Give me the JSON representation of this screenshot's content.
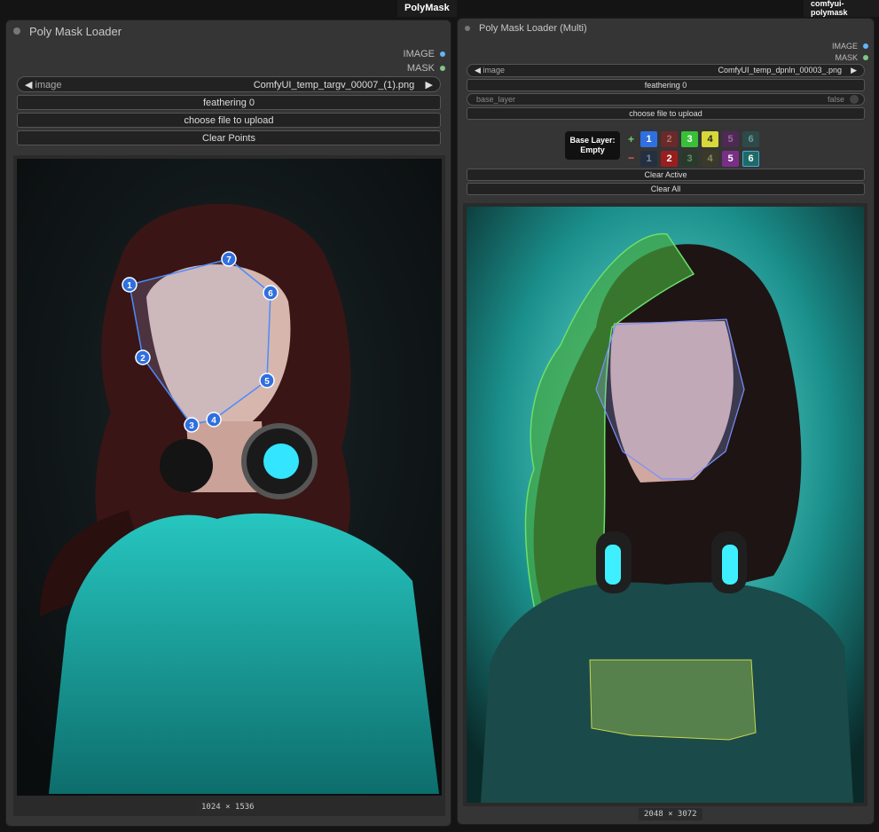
{
  "header": {
    "left_group": "PolyMask",
    "right_group": "comfyui-polymask"
  },
  "left_node": {
    "title": "Poly Mask Loader",
    "outputs": [
      "IMAGE",
      "MASK"
    ],
    "image_label": "image",
    "image_value": "ComfyUI_temp_targv_00007_(1).png",
    "feathering": "feathering  0",
    "upload": "choose file to upload",
    "clear": "Clear Points",
    "dims": "1024 × 1536",
    "points": [
      "1",
      "2",
      "3",
      "4",
      "5",
      "6",
      "7"
    ]
  },
  "right_node": {
    "title": "Poly Mask Loader (Multi)",
    "outputs": [
      "IMAGE",
      "MASK"
    ],
    "image_label": "image",
    "image_value": "ComfyUI_temp_dpnln_00003_.png",
    "feathering": "feathering  0",
    "base_layer_label": "base_layer",
    "base_layer_value": "false",
    "upload": "choose file to upload",
    "base_layer_status": "Base Layer: Empty",
    "plus": "+",
    "minus": "−",
    "add_layers": [
      "1",
      "2",
      "3",
      "4",
      "5",
      "6"
    ],
    "sub_layers": [
      "1",
      "2",
      "3",
      "4",
      "5",
      "6"
    ],
    "clear_active": "Clear Active",
    "clear_all": "Clear All",
    "dims": "2048 × 3072"
  },
  "colors": {
    "accent_blue": "#3b82f6",
    "green": "#4caf50",
    "yellow": "#c8c83c",
    "purple": "#7a2f86",
    "teal": "#1fc6c2"
  }
}
